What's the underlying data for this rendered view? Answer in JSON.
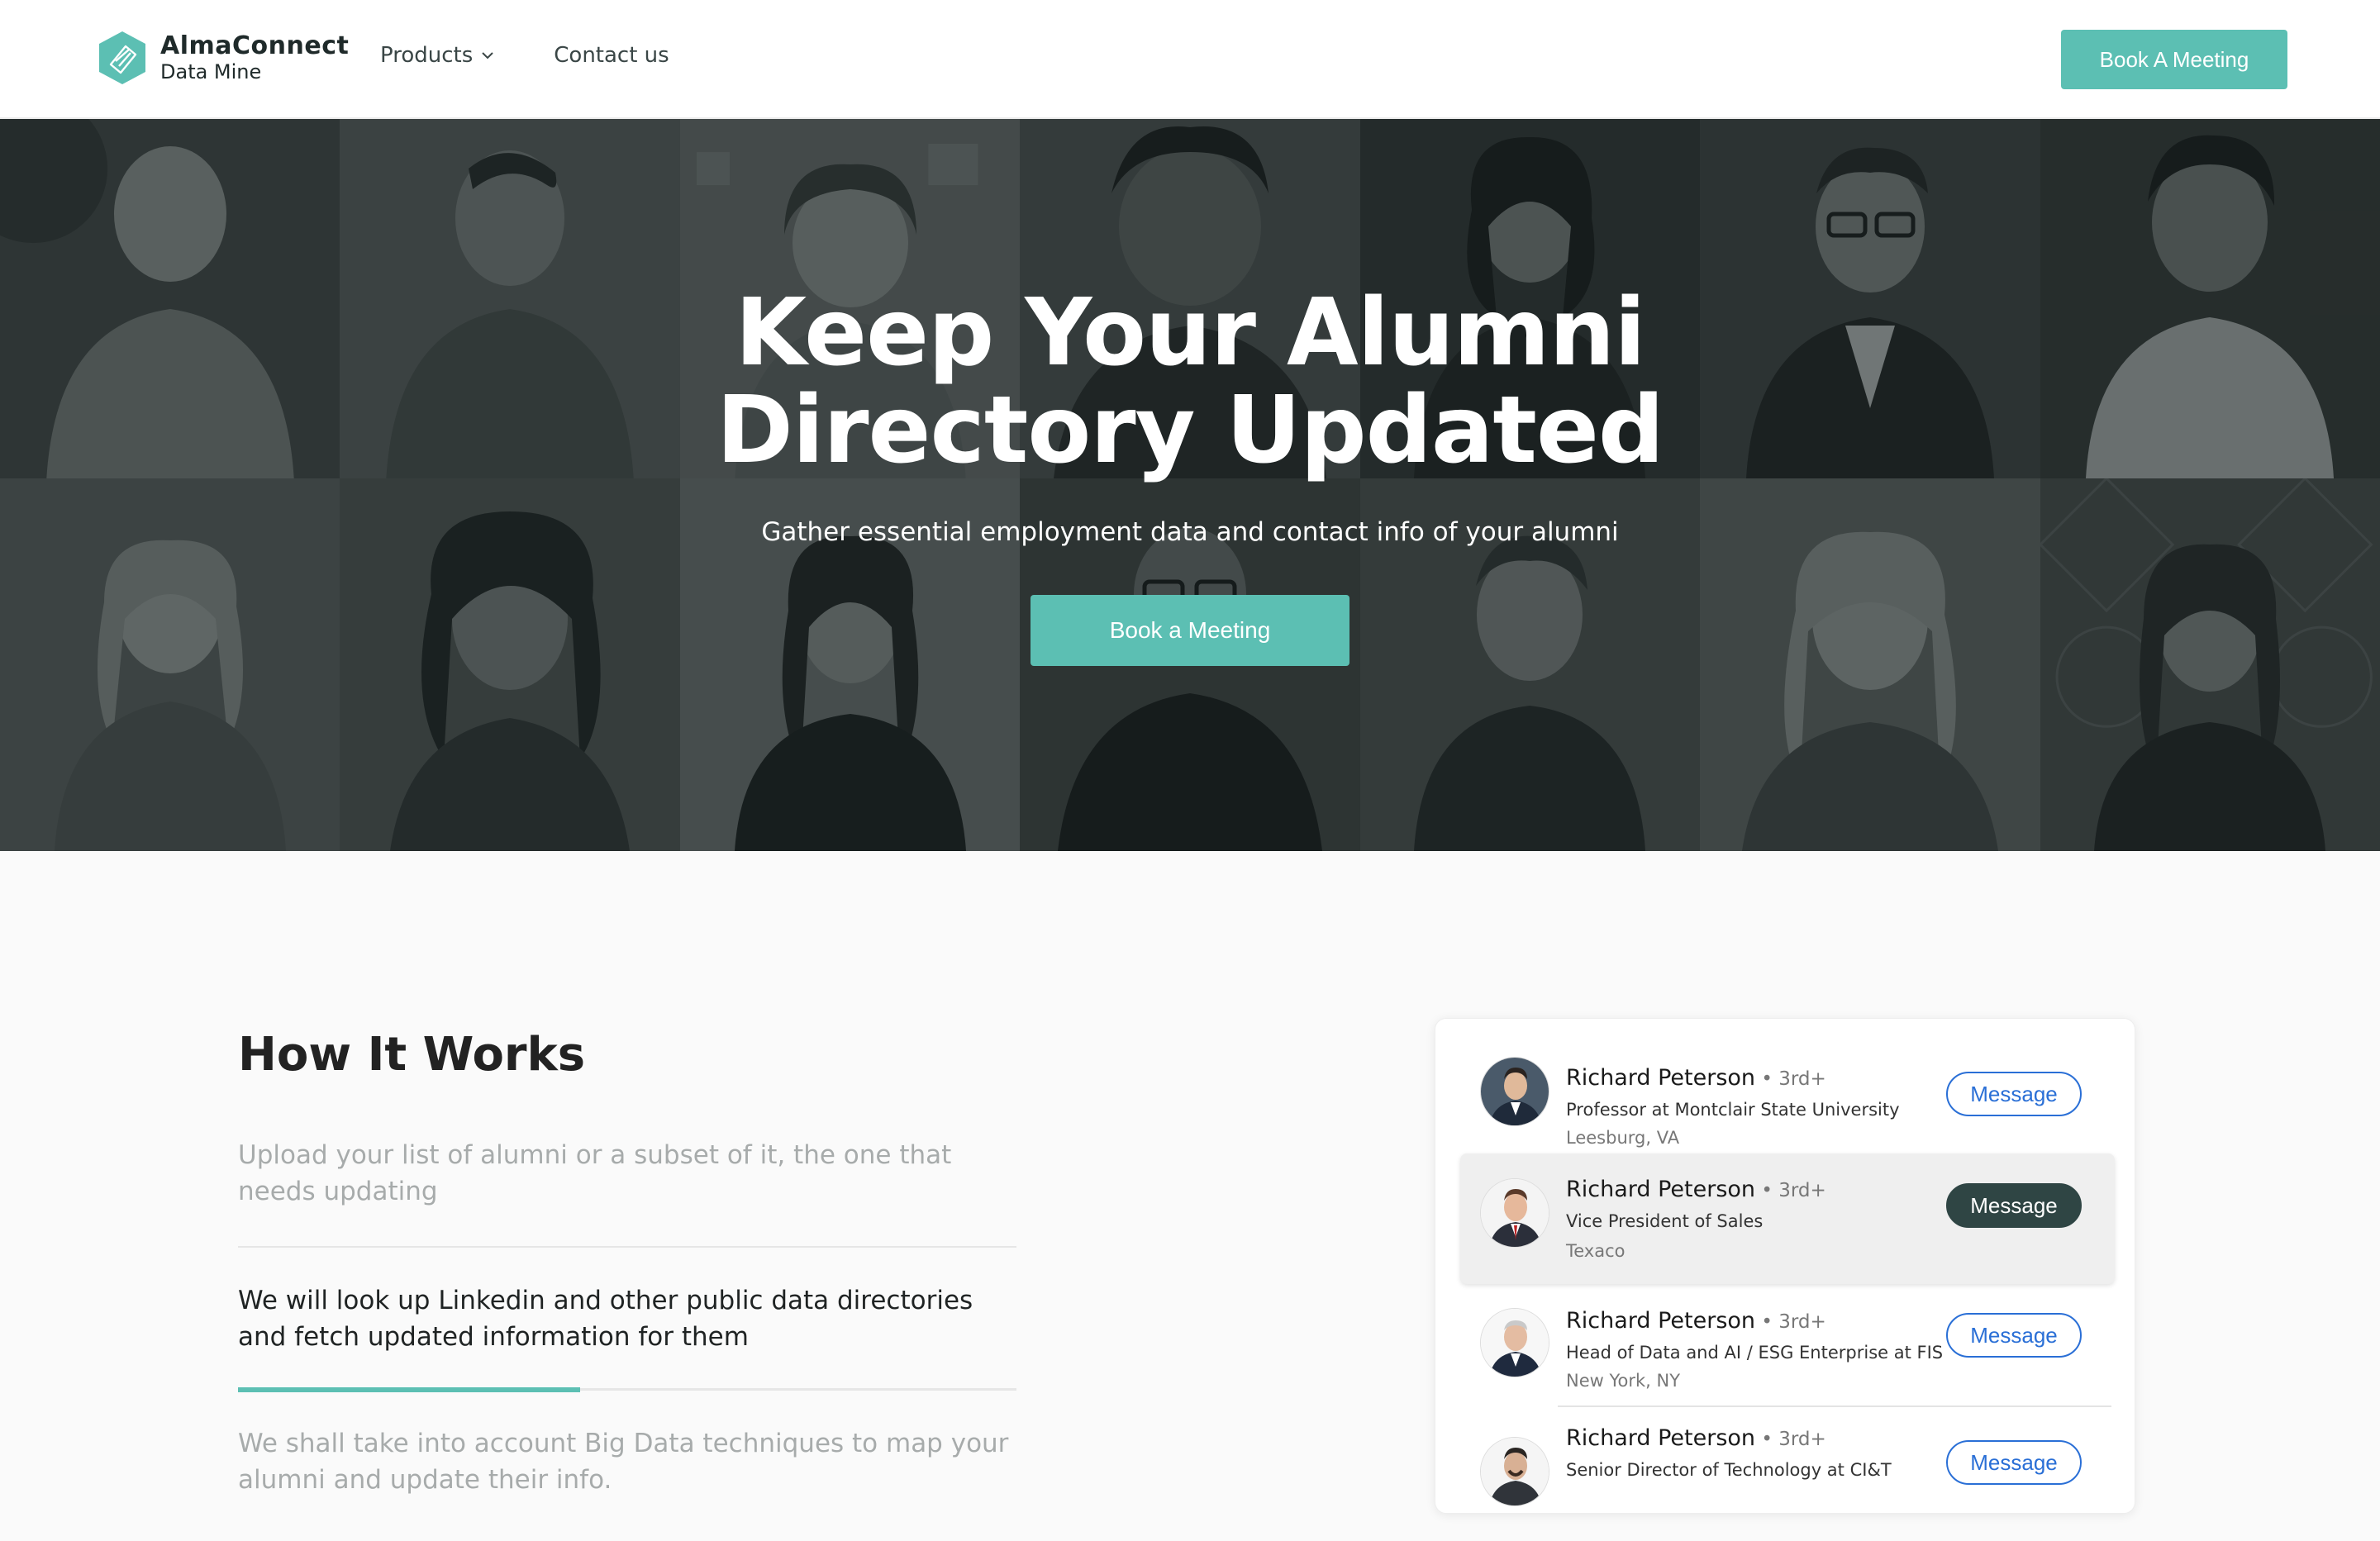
{
  "brand": {
    "name": "AlmaConnect",
    "sub": "Data Mine"
  },
  "nav": {
    "products": "Products",
    "contact": "Contact us"
  },
  "header_button": "Book A Meeting",
  "hero": {
    "title_line1": "Keep Your Alumni",
    "title_line2": "Directory Updated",
    "subtitle": "Gather essential employment data and contact info of your alumni",
    "button": "Book a Meeting"
  },
  "how": {
    "title": "How It Works",
    "steps": [
      "Upload your list of alumni or a subset of it, the one that needs updating",
      "We will look up Linkedin and other public data directories and fetch updated information for them",
      "We shall take into account Big Data techniques to map your alumni and update their info."
    ],
    "active_step": 2,
    "progress": 0.44
  },
  "profiles": [
    {
      "name": "Richard Peterson",
      "degree": " • 3rd+",
      "role": "Professor at Montclair State University",
      "location": "Leesburg, VA",
      "button": "Message",
      "highlighted": false
    },
    {
      "name": "Richard Peterson",
      "degree": " • 3rd+",
      "role": "Vice President of Sales",
      "location": "Texaco",
      "button": "Message",
      "highlighted": true
    },
    {
      "name": "Richard Peterson",
      "degree": " • 3rd+",
      "role": "Head of Data and AI / ESG Enterprise at FIS",
      "location": "New York, NY",
      "button": "Message",
      "highlighted": false
    },
    {
      "name": "Richard Peterson",
      "degree": " • 3rd+",
      "role": "Senior Director of Technology at CI&T",
      "location": "",
      "button": "Message",
      "highlighted": false
    }
  ],
  "colors": {
    "accent": "#5cbfb3",
    "link_blue": "#2a6fd6",
    "dark_button": "#2f4544"
  }
}
